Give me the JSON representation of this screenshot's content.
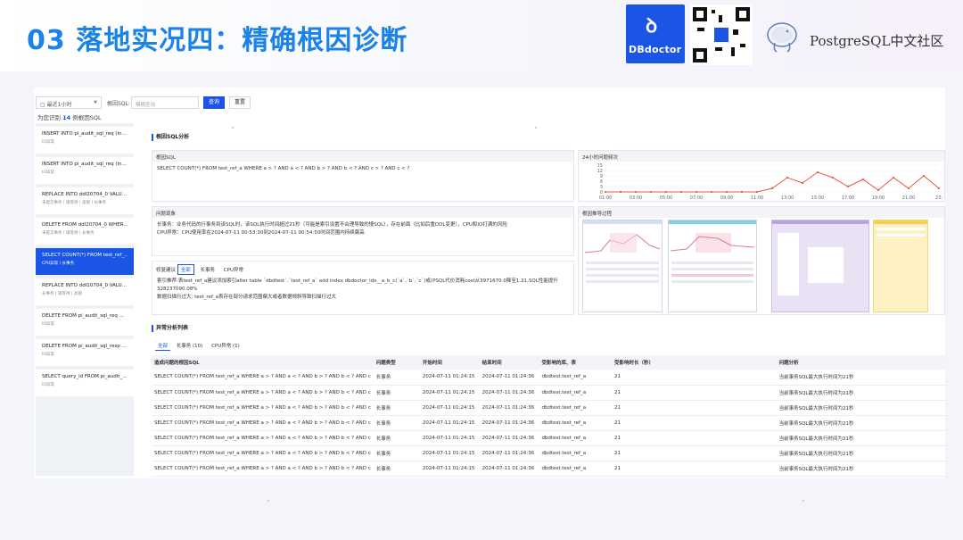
{
  "slide": {
    "title": "03 落地实况四：精确根因诊断",
    "brand": "DBdoctor",
    "community": "PostgreSQL中文社区"
  },
  "toolbar": {
    "time_select": "最近1小时",
    "sql_label": "根因SQL:",
    "sql_placeholder": "模糊查询",
    "query_button": "查询",
    "reset_button": "重置"
  },
  "summary": {
    "prefix": "为您识别",
    "count": "14",
    "suffix": "例根因SQL"
  },
  "sql_list": [
    {
      "title": "INSERT INTO pi_audit_sql_req (in...",
      "sub": "IO异常"
    },
    {
      "title": "INSERT INTO pi_audit_sql_req (in...",
      "sub": "IO异常"
    },
    {
      "title": "REPLACE INTO ddl20704_0 VALU...",
      "sub": "未提交事务丨锁等待丨高锁丨长事务"
    },
    {
      "title": "DELETE FROM ddl20704_0 WHER...",
      "sub": "未提交事务丨锁等待丨长事务"
    },
    {
      "title": "SELECT COUNT(*) FROM test_ref_...",
      "sub": "CPU异常丨长事务"
    },
    {
      "title": "REPLACE INTO ddl10704_0 VALU...",
      "sub": "长事务丨锁等待丨高锁"
    },
    {
      "title": "DELETE FROM pi_audit_sql_req ...",
      "sub": "IO异常"
    },
    {
      "title": "DELETE FROM pi_audit_sql_resp ...",
      "sub": "IO异常"
    },
    {
      "title": "SELECT query_id FROM pi_audit_...",
      "sub": "IO异常"
    }
  ],
  "analysis": {
    "section_title": "根因SQL分析",
    "root_sql_header": "根因SQL",
    "root_sql": "SELECT COUNT(*) FROM test_ref_a WHERE a > ? AND a < ? AND b > ? AND b < ? AND c > ? AND c < ?",
    "phenomenon_header": "问题现象",
    "phenomenon_lines": [
      "长事务：业务代码的行事务到该SQL时，该SQL执行时间超过21秒（可能是索引设置不合理导致的慢SQL），存在前面（比如后重DDL变更），CPU和IO打满的风险",
      "CPU异常：CPU使用率在2024-07-11 00:53:30到2024-07-11 00:54:50时间范围内持续飙高"
    ],
    "fix_header": "修复建议",
    "fix_tabs": [
      "全部",
      "长事务",
      "CPU异常"
    ],
    "fix_lines": [
      "索引推荐:表test_ref_a建议添加索引alter table `dbdtest`.`test_ref_a` add index dbdoctor_idx__a_b_c(`a`,`b`,`c`)或(PSQL代价消耗cost从3971670.0降至1.21,SQL性能提升",
      "328237090.08%",
      "数据扫描行过大: test_ref_a表存在部分请求范围偏大或者数据倾斜导致扫描行过大"
    ],
    "freq_header": "24小时问题频次",
    "trace_header": "根因推导过程"
  },
  "chart_data": {
    "type": "line",
    "title": "24小时问题频次",
    "x": [
      "01:00",
      "02:00",
      "03:00",
      "04:00",
      "05:00",
      "06:00",
      "07:00",
      "08:00",
      "09:00",
      "10:00",
      "11:00",
      "12:00",
      "13:00",
      "14:00",
      "15:00",
      "16:00",
      "17:00",
      "18:00",
      "19:00",
      "20:00",
      "21:00",
      "22:00",
      "23:00"
    ],
    "tick_labels": [
      "01:00",
      "03:00",
      "05:00",
      "07:00",
      "09:00",
      "11:00",
      "13:00",
      "15:00",
      "17:00",
      "19:00",
      "21:00",
      "23:"
    ],
    "values": [
      0,
      0,
      0,
      0,
      0,
      0,
      0,
      0,
      0,
      0,
      0,
      2,
      8,
      5,
      11,
      8,
      3,
      7,
      1,
      8,
      2,
      9,
      2
    ],
    "yticks": [
      0,
      3,
      6,
      9,
      12,
      15
    ],
    "ylim": [
      0,
      15
    ],
    "color": "#e8593e"
  },
  "anomaly": {
    "section_title": "异常分析列表",
    "tabs": [
      "全部",
      "长事务 (10)",
      "CPU异常 (1)"
    ],
    "headers": [
      "造成问题的根因SQL",
      "问题类型",
      "开始时间",
      "结束时间",
      "受影响的库、表",
      "受影响时长（秒）",
      "问题分析"
    ],
    "rows": [
      [
        "SELECT COUNT(*) FROM test_ref_a WHERE a > ? AND a < ? AND b > ? AND b < ? AND c",
        "长事务",
        "2024-07-11 01:24:15",
        "2024-07-11 01:24:36",
        "dbdtest.test_ref_a",
        "21",
        "当前事务SQL最大执行时间为21秒"
      ],
      [
        "SELECT COUNT(*) FROM test_ref_a WHERE a > ? AND a < ? AND b > ? AND b < ? AND c",
        "长事务",
        "2024-07-11 01:24:15",
        "2024-07-11 01:24:36",
        "dbdtest.test_ref_a",
        "21",
        "当前事务SQL最大执行时间为21秒"
      ],
      [
        "SELECT COUNT(*) FROM test_ref_a WHERE a > ? AND a < ? AND b > ? AND b < ? AND c",
        "长事务",
        "2024-07-11 01:24:15",
        "2024-07-11 01:24:36",
        "dbdtest.test_ref_a",
        "21",
        "当前事务SQL最大执行时间为21秒"
      ],
      [
        "SELECT COUNT(*) FROM test_ref_a WHERE a > ? AND a < ? AND b > ? AND b < ? AND c",
        "长事务",
        "2024-07-11 01:24:15",
        "2024-07-11 01:24:36",
        "dbdtest.test_ref_a",
        "21",
        "当前事务SQL最大执行时间为21秒"
      ],
      [
        "SELECT COUNT(*) FROM test_ref_a WHERE a > ? AND a < ? AND b > ? AND b < ? AND c",
        "长事务",
        "2024-07-11 01:24:15",
        "2024-07-11 01:24:36",
        "dbdtest.test_ref_a",
        "21",
        "当前事务SQL最大执行时间为21秒"
      ],
      [
        "SELECT COUNT(*) FROM test_ref_a WHERE a > ? AND a < ? AND b > ? AND b < ? AND c",
        "长事务",
        "2024-07-11 01:24:15",
        "2024-07-11 01:24:36",
        "dbdtest.test_ref_a",
        "21",
        "当前事务SQL最大执行时间为21秒"
      ],
      [
        "SELECT COUNT(*) FROM test_ref_a WHERE a > ? AND a < ? AND b > ? AND b < ? AND c",
        "长事务",
        "2024-07-11 01:24:15",
        "2024-07-11 01:24:36",
        "dbdtest.test_ref_a",
        "21",
        "当前事务SQL最大执行时间为21秒"
      ]
    ]
  },
  "colors": {
    "accent": "#1b55e6",
    "title": "#1a82e8",
    "line": "#e8593e"
  }
}
